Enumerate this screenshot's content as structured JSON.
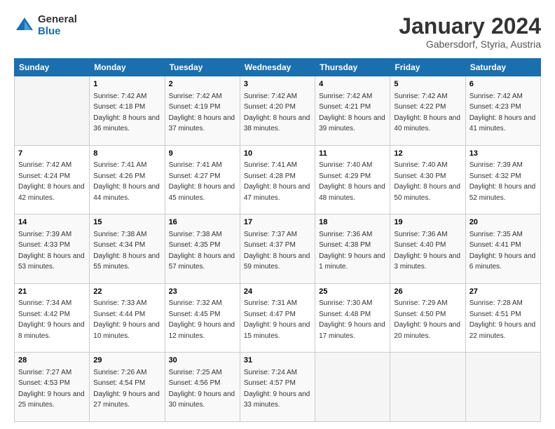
{
  "logo": {
    "general": "General",
    "blue": "Blue"
  },
  "header": {
    "title": "January 2024",
    "location": "Gabersdorf, Styria, Austria"
  },
  "days_of_week": [
    "Sunday",
    "Monday",
    "Tuesday",
    "Wednesday",
    "Thursday",
    "Friday",
    "Saturday"
  ],
  "weeks": [
    [
      {
        "day": "",
        "sunrise": "",
        "sunset": "",
        "daylight": ""
      },
      {
        "day": "1",
        "sunrise": "7:42 AM",
        "sunset": "4:18 PM",
        "daylight": "8 hours and 36 minutes."
      },
      {
        "day": "2",
        "sunrise": "7:42 AM",
        "sunset": "4:19 PM",
        "daylight": "8 hours and 37 minutes."
      },
      {
        "day": "3",
        "sunrise": "7:42 AM",
        "sunset": "4:20 PM",
        "daylight": "8 hours and 38 minutes."
      },
      {
        "day": "4",
        "sunrise": "7:42 AM",
        "sunset": "4:21 PM",
        "daylight": "8 hours and 39 minutes."
      },
      {
        "day": "5",
        "sunrise": "7:42 AM",
        "sunset": "4:22 PM",
        "daylight": "8 hours and 40 minutes."
      },
      {
        "day": "6",
        "sunrise": "7:42 AM",
        "sunset": "4:23 PM",
        "daylight": "8 hours and 41 minutes."
      }
    ],
    [
      {
        "day": "7",
        "sunrise": "7:42 AM",
        "sunset": "4:24 PM",
        "daylight": "8 hours and 42 minutes."
      },
      {
        "day": "8",
        "sunrise": "7:41 AM",
        "sunset": "4:26 PM",
        "daylight": "8 hours and 44 minutes."
      },
      {
        "day": "9",
        "sunrise": "7:41 AM",
        "sunset": "4:27 PM",
        "daylight": "8 hours and 45 minutes."
      },
      {
        "day": "10",
        "sunrise": "7:41 AM",
        "sunset": "4:28 PM",
        "daylight": "8 hours and 47 minutes."
      },
      {
        "day": "11",
        "sunrise": "7:40 AM",
        "sunset": "4:29 PM",
        "daylight": "8 hours and 48 minutes."
      },
      {
        "day": "12",
        "sunrise": "7:40 AM",
        "sunset": "4:30 PM",
        "daylight": "8 hours and 50 minutes."
      },
      {
        "day": "13",
        "sunrise": "7:39 AM",
        "sunset": "4:32 PM",
        "daylight": "8 hours and 52 minutes."
      }
    ],
    [
      {
        "day": "14",
        "sunrise": "7:39 AM",
        "sunset": "4:33 PM",
        "daylight": "8 hours and 53 minutes."
      },
      {
        "day": "15",
        "sunrise": "7:38 AM",
        "sunset": "4:34 PM",
        "daylight": "8 hours and 55 minutes."
      },
      {
        "day": "16",
        "sunrise": "7:38 AM",
        "sunset": "4:35 PM",
        "daylight": "8 hours and 57 minutes."
      },
      {
        "day": "17",
        "sunrise": "7:37 AM",
        "sunset": "4:37 PM",
        "daylight": "8 hours and 59 minutes."
      },
      {
        "day": "18",
        "sunrise": "7:36 AM",
        "sunset": "4:38 PM",
        "daylight": "9 hours and 1 minute."
      },
      {
        "day": "19",
        "sunrise": "7:36 AM",
        "sunset": "4:40 PM",
        "daylight": "9 hours and 3 minutes."
      },
      {
        "day": "20",
        "sunrise": "7:35 AM",
        "sunset": "4:41 PM",
        "daylight": "9 hours and 6 minutes."
      }
    ],
    [
      {
        "day": "21",
        "sunrise": "7:34 AM",
        "sunset": "4:42 PM",
        "daylight": "9 hours and 8 minutes."
      },
      {
        "day": "22",
        "sunrise": "7:33 AM",
        "sunset": "4:44 PM",
        "daylight": "9 hours and 10 minutes."
      },
      {
        "day": "23",
        "sunrise": "7:32 AM",
        "sunset": "4:45 PM",
        "daylight": "9 hours and 12 minutes."
      },
      {
        "day": "24",
        "sunrise": "7:31 AM",
        "sunset": "4:47 PM",
        "daylight": "9 hours and 15 minutes."
      },
      {
        "day": "25",
        "sunrise": "7:30 AM",
        "sunset": "4:48 PM",
        "daylight": "9 hours and 17 minutes."
      },
      {
        "day": "26",
        "sunrise": "7:29 AM",
        "sunset": "4:50 PM",
        "daylight": "9 hours and 20 minutes."
      },
      {
        "day": "27",
        "sunrise": "7:28 AM",
        "sunset": "4:51 PM",
        "daylight": "9 hours and 22 minutes."
      }
    ],
    [
      {
        "day": "28",
        "sunrise": "7:27 AM",
        "sunset": "4:53 PM",
        "daylight": "9 hours and 25 minutes."
      },
      {
        "day": "29",
        "sunrise": "7:26 AM",
        "sunset": "4:54 PM",
        "daylight": "9 hours and 27 minutes."
      },
      {
        "day": "30",
        "sunrise": "7:25 AM",
        "sunset": "4:56 PM",
        "daylight": "9 hours and 30 minutes."
      },
      {
        "day": "31",
        "sunrise": "7:24 AM",
        "sunset": "4:57 PM",
        "daylight": "9 hours and 33 minutes."
      },
      {
        "day": "",
        "sunrise": "",
        "sunset": "",
        "daylight": ""
      },
      {
        "day": "",
        "sunrise": "",
        "sunset": "",
        "daylight": ""
      },
      {
        "day": "",
        "sunrise": "",
        "sunset": "",
        "daylight": ""
      }
    ]
  ]
}
